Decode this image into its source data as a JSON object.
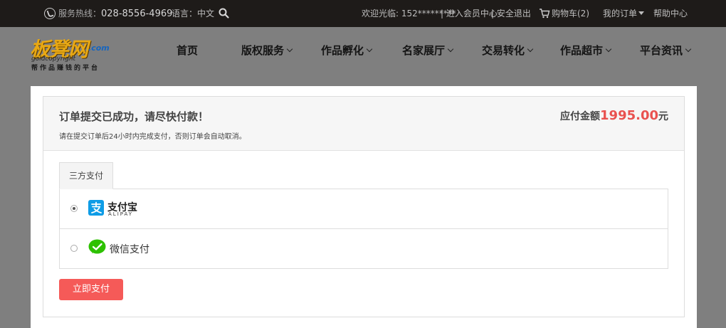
{
  "topbar": {
    "hotline_label": "服务热线：",
    "hotline_number": "028-8556-4969",
    "language": "语言：中文",
    "welcome": "欢迎光临: 152*********",
    "member_center": "| 进入会员中心",
    "logout": "| 安全退出",
    "cart": "购物车(2)",
    "my_orders": "我的订单",
    "help": "帮助中心"
  },
  "logo": {
    "main": "板凳网",
    "com": ".com",
    "en": "goldcopyright",
    "slogan": "帮作品赚钱的平台"
  },
  "nav": {
    "items": [
      {
        "label": "首页",
        "dropdown": false
      },
      {
        "label": "版权服务",
        "dropdown": true
      },
      {
        "label": "作品孵化",
        "dropdown": true
      },
      {
        "label": "名家展厅",
        "dropdown": true
      },
      {
        "label": "交易转化",
        "dropdown": true
      },
      {
        "label": "作品超市",
        "dropdown": true
      },
      {
        "label": "平台资讯",
        "dropdown": true
      }
    ]
  },
  "order": {
    "title": "订单提交已成功，请尽快付款！",
    "note": "请在提交订单后24小时内完成支付，否则订单会自动取消。",
    "amount_label": "应付金额",
    "amount_value": "1995.00",
    "amount_unit": "元"
  },
  "payment": {
    "tab_label": "三方支付",
    "options": [
      {
        "id": "alipay",
        "label": "支付宝",
        "sublabel": "ALIPAY",
        "selected": true
      },
      {
        "id": "wechat",
        "label": "微信支付",
        "selected": false
      }
    ],
    "submit_label": "立即支付"
  },
  "colors": {
    "topbar_bg": "#1e1b19",
    "accent_red": "#f55a58",
    "price_red": "#e9514f",
    "alipay_blue": "#0e9ce6",
    "wechat_green": "#2dc100"
  }
}
